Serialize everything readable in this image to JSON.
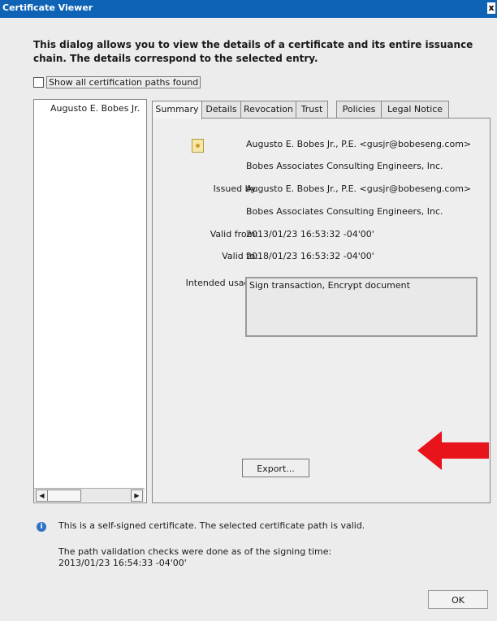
{
  "window": {
    "title": "Certificate Viewer",
    "close_glyph": "x"
  },
  "description": "This dialog allows you to view the details of a certificate and its entire issuance chain. The details correspond to the selected entry.",
  "show_all_paths": {
    "label": "Show all certification paths found",
    "checked": false
  },
  "cert_tree": {
    "items": [
      "Augusto E. Bobes Jr."
    ]
  },
  "tabs": [
    {
      "label": "Summary",
      "active": true
    },
    {
      "label": "Details",
      "active": false
    },
    {
      "label": "Revocation",
      "active": false
    },
    {
      "label": "Trust",
      "active": false
    },
    {
      "label": "Policies",
      "active": false
    },
    {
      "label": "Legal Notice",
      "active": false
    }
  ],
  "summary": {
    "subject_name": "Augusto E. Bobes Jr., P.E. <gusjr@bobeseng.com>",
    "subject_org": "Bobes Associates Consulting Engineers, Inc.",
    "issued_by_label": "Issued by:",
    "issuer_name": "Augusto E. Bobes Jr., P.E. <gusjr@bobeseng.com>",
    "issuer_org": "Bobes Associates Consulting Engineers, Inc.",
    "valid_from_label": "Valid from:",
    "valid_from": "2013/01/23 16:53:32 -04'00'",
    "valid_to_label": "Valid to:",
    "valid_to": "2018/01/23 16:53:32 -04'00'",
    "intended_usage_label": "Intended usage:",
    "intended_usage": "Sign transaction, Encrypt document",
    "export_label": "Export..."
  },
  "status": {
    "line1": "This is a self-signed certificate. The selected certificate path is valid.",
    "line2": "The path validation checks were done as of the signing time:",
    "line3": "2013/01/23 16:54:33 -04'00'"
  },
  "ok_label": "OK",
  "colors": {
    "titlebar": "#0e63b6",
    "annotation_arrow": "#e8141c",
    "info_icon": "#2e72c4"
  },
  "icons": {
    "certificate": "certificate-icon",
    "info": "info-icon",
    "close": "close-icon",
    "annotation": "arrow-left-icon"
  }
}
